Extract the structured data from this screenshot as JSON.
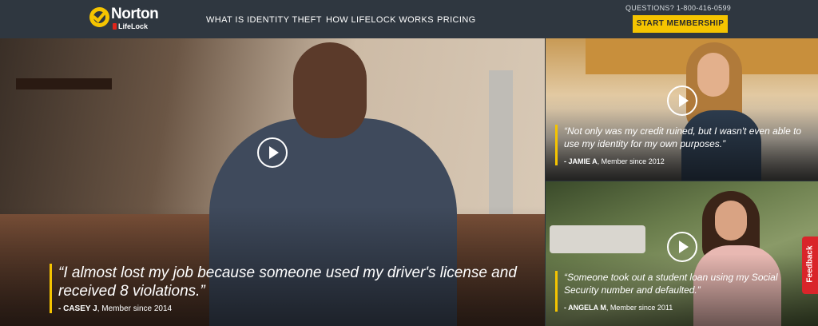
{
  "header": {
    "brand": "Norton",
    "sub_brand": "LifeLock",
    "nav": [
      "WHAT IS IDENTITY THEFT",
      "HOW LIFELOCK WORKS",
      "PRICING"
    ],
    "phone_label": "QUESTIONS? 1-800-416-0599",
    "cta_label": "START MEMBERSHIP"
  },
  "testimonials": [
    {
      "quote": "“I almost lost my job because someone used my driver's license and received 8 violations.”",
      "name": "- CASEY J",
      "member_since": ", Member since 2014"
    },
    {
      "quote": "“Not only was my credit ruined, but I wasn't even able to use my identity for my own purposes.”",
      "name": "- JAMIE A",
      "member_since": ", Member since 2012"
    },
    {
      "quote": "“Someone took out a student loan using my Social Security number and defaulted.”",
      "name": "- ANGELA M",
      "member_since": ", Member since 2011"
    }
  ],
  "feedback_label": "Feedback",
  "colors": {
    "accent": "#f5c400",
    "header_bg": "#2f3740",
    "feedback": "#d9252a"
  }
}
